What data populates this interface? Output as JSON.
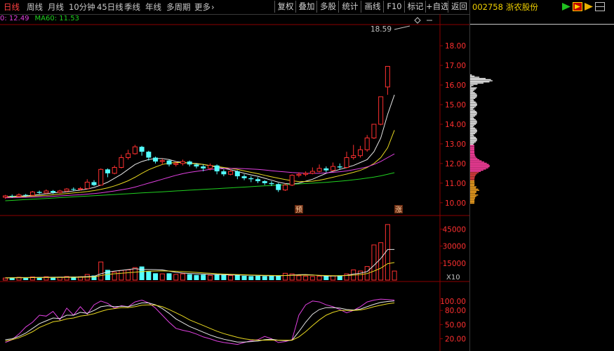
{
  "toolbar": {
    "tabs": [
      {
        "label": "日线",
        "active": true
      },
      {
        "label": "周线",
        "active": false
      },
      {
        "label": "月线",
        "active": false
      },
      {
        "label": "10分钟",
        "active": false
      },
      {
        "label": "45日线",
        "active": false
      },
      {
        "label": "季线",
        "active": false
      },
      {
        "label": "年线",
        "active": false
      },
      {
        "label": "多周期",
        "active": false
      },
      {
        "label": "更多",
        "active": false
      }
    ],
    "buttons": [
      "复权",
      "叠加",
      "多股",
      "统计",
      "画线",
      "F10",
      "标记",
      "+自选",
      "返回"
    ]
  },
  "ma_info": {
    "items": [
      {
        "text": "0: 12.49",
        "color": "#e040e0"
      },
      {
        "text": "MA60: 11.53",
        "color": "#20d020"
      }
    ]
  },
  "stock": {
    "code": "002758",
    "name": "浙农股份"
  },
  "price_axis": {
    "labels": [
      "18.00",
      "17.00",
      "16.00",
      "15.00",
      "14.00",
      "13.00",
      "12.00",
      "11.00",
      "10.00"
    ]
  },
  "volume_axis": {
    "labels": [
      "45000",
      "30000",
      "15000"
    ],
    "unit_label": "X10"
  },
  "indicator_axis": {
    "labels": [
      "100.00",
      "80.00",
      "50.00",
      "20.00"
    ]
  },
  "annotations": {
    "high_label": "18.59",
    "marker_pre": "预",
    "marker_up": "涨"
  },
  "chart_data": {
    "type": "candlestick",
    "price_ylim": [
      9.6,
      18.9
    ],
    "candles": [
      [
        10.28,
        10.35,
        10.2,
        10.4
      ],
      [
        10.35,
        10.33,
        10.25,
        10.42
      ],
      [
        10.33,
        10.4,
        10.3,
        10.48
      ],
      [
        10.4,
        10.38,
        10.3,
        10.45
      ],
      [
        10.38,
        10.55,
        10.35,
        10.6
      ],
      [
        10.55,
        10.5,
        10.45,
        10.62
      ],
      [
        10.5,
        10.6,
        10.45,
        10.68
      ],
      [
        10.6,
        10.52,
        10.45,
        10.65
      ],
      [
        10.52,
        10.6,
        10.48,
        10.66
      ],
      [
        10.6,
        10.7,
        10.55,
        10.75
      ],
      [
        10.7,
        10.68,
        10.6,
        10.78
      ],
      [
        10.68,
        10.72,
        10.62,
        10.8
      ],
      [
        10.72,
        11.05,
        10.7,
        11.2
      ],
      [
        11.05,
        10.9,
        10.85,
        11.15
      ],
      [
        10.9,
        11.7,
        10.88,
        11.75
      ],
      [
        11.7,
        11.5,
        11.3,
        11.75
      ],
      [
        11.5,
        11.8,
        11.45,
        11.9
      ],
      [
        11.8,
        12.3,
        11.75,
        12.45
      ],
      [
        12.3,
        12.5,
        12.2,
        12.7
      ],
      [
        12.5,
        12.85,
        12.45,
        12.95
      ],
      [
        12.85,
        12.6,
        12.4,
        12.9
      ],
      [
        12.6,
        12.3,
        12.15,
        12.65
      ],
      [
        12.3,
        12.1,
        12.0,
        12.35
      ],
      [
        12.1,
        12.15,
        11.95,
        12.25
      ],
      [
        12.15,
        11.95,
        11.85,
        12.2
      ],
      [
        11.95,
        12.0,
        11.85,
        12.1
      ],
      [
        12.0,
        12.1,
        11.9,
        12.2
      ],
      [
        12.1,
        11.95,
        11.85,
        12.15
      ],
      [
        11.95,
        11.85,
        11.75,
        12.0
      ],
      [
        11.85,
        11.75,
        11.6,
        11.95
      ],
      [
        11.75,
        11.9,
        11.65,
        12.0
      ],
      [
        11.9,
        11.6,
        11.45,
        11.95
      ],
      [
        11.6,
        11.45,
        11.35,
        11.7
      ],
      [
        11.45,
        11.6,
        11.4,
        11.7
      ],
      [
        11.6,
        11.35,
        11.2,
        11.65
      ],
      [
        11.35,
        11.25,
        11.15,
        11.45
      ],
      [
        11.25,
        11.2,
        11.05,
        11.35
      ],
      [
        11.2,
        11.1,
        11.0,
        11.3
      ],
      [
        11.1,
        11.0,
        10.9,
        11.15
      ],
      [
        11.0,
        10.95,
        10.85,
        11.1
      ],
      [
        10.95,
        10.65,
        10.55,
        11.0
      ],
      [
        10.65,
        10.9,
        10.6,
        10.98
      ],
      [
        10.9,
        11.4,
        10.85,
        11.45
      ],
      [
        11.4,
        11.45,
        11.3,
        11.55
      ],
      [
        11.45,
        11.5,
        11.35,
        11.6
      ],
      [
        11.5,
        11.6,
        11.45,
        11.8
      ],
      [
        11.6,
        11.75,
        11.55,
        11.95
      ],
      [
        11.75,
        11.65,
        11.55,
        11.85
      ],
      [
        11.65,
        11.85,
        11.6,
        12.05
      ],
      [
        11.85,
        11.8,
        11.7,
        12.0
      ],
      [
        11.8,
        12.3,
        11.75,
        12.6
      ],
      [
        12.3,
        12.4,
        12.2,
        12.95
      ],
      [
        12.4,
        12.7,
        12.3,
        12.9
      ],
      [
        12.7,
        13.3,
        12.6,
        13.45
      ],
      [
        13.3,
        14.0,
        13.25,
        14.0
      ],
      [
        14.0,
        15.4,
        13.95,
        15.4
      ],
      [
        15.9,
        16.95,
        15.5,
        16.95
      ]
    ],
    "ma": [
      {
        "name": "MA5",
        "color": "#e8e8e8",
        "values": [
          10.3,
          10.32,
          10.34,
          10.35,
          10.38,
          10.42,
          10.46,
          10.5,
          10.53,
          10.56,
          10.6,
          10.64,
          10.7,
          10.78,
          10.9,
          11.05,
          11.25,
          11.45,
          11.7,
          11.95,
          12.1,
          12.2,
          12.25,
          12.25,
          12.2,
          12.1,
          12.05,
          12.02,
          12.0,
          11.95,
          11.88,
          11.82,
          11.75,
          11.68,
          11.6,
          11.5,
          11.42,
          11.35,
          11.25,
          11.15,
          11.05,
          10.98,
          10.95,
          11.0,
          11.1,
          11.2,
          11.35,
          11.5,
          11.6,
          11.7,
          11.8,
          11.9,
          12.05,
          12.2,
          12.6,
          13.3,
          14.5,
          15.5
        ]
      },
      {
        "name": "MA10",
        "color": "#e8d820",
        "values": [
          10.28,
          10.3,
          10.31,
          10.32,
          10.34,
          10.36,
          10.38,
          10.41,
          10.44,
          10.47,
          10.5,
          10.53,
          10.57,
          10.62,
          10.68,
          10.76,
          10.86,
          10.98,
          11.12,
          11.3,
          11.5,
          11.68,
          11.82,
          11.95,
          12.02,
          12.05,
          12.05,
          12.02,
          11.98,
          11.95,
          11.9,
          11.85,
          11.8,
          11.75,
          11.7,
          11.62,
          11.55,
          11.48,
          11.4,
          11.32,
          11.25,
          11.18,
          11.12,
          11.08,
          11.08,
          11.1,
          11.15,
          11.22,
          11.3,
          11.38,
          11.46,
          11.55,
          11.65,
          11.8,
          12.0,
          12.3,
          12.8,
          13.7
        ]
      },
      {
        "name": "MA20",
        "color": "#e040e0",
        "values": [
          10.25,
          10.26,
          10.27,
          10.28,
          10.29,
          10.3,
          10.31,
          10.33,
          10.35,
          10.37,
          10.39,
          10.41,
          10.44,
          10.47,
          10.5,
          10.55,
          10.6,
          10.66,
          10.72,
          10.8,
          10.9,
          11.0,
          11.1,
          11.2,
          11.3,
          11.4,
          11.48,
          11.55,
          11.6,
          11.65,
          11.7,
          11.72,
          11.74,
          11.75,
          11.75,
          11.74,
          11.72,
          11.7,
          11.67,
          11.63,
          11.6,
          11.57,
          11.54,
          11.52,
          11.5,
          11.5,
          11.5,
          11.52,
          11.55,
          11.58,
          11.62,
          11.68,
          11.75,
          11.83,
          11.95,
          12.1,
          12.3,
          12.49
        ]
      },
      {
        "name": "MA60",
        "color": "#20d020",
        "values": [
          10.1,
          10.12,
          10.14,
          10.16,
          10.18,
          10.2,
          10.22,
          10.24,
          10.26,
          10.28,
          10.3,
          10.32,
          10.34,
          10.36,
          10.38,
          10.4,
          10.42,
          10.44,
          10.46,
          10.48,
          10.5,
          10.52,
          10.54,
          10.56,
          10.58,
          10.6,
          10.62,
          10.64,
          10.66,
          10.68,
          10.7,
          10.72,
          10.74,
          10.76,
          10.78,
          10.8,
          10.82,
          10.84,
          10.86,
          10.88,
          10.9,
          10.92,
          10.94,
          10.96,
          10.98,
          11.0,
          11.02,
          11.04,
          11.07,
          11.1,
          11.13,
          11.17,
          11.21,
          11.26,
          11.31,
          11.37,
          11.45,
          11.53
        ]
      }
    ],
    "volume_ylim": [
      0,
      52000
    ],
    "volumes": [
      1800,
      2200,
      2500,
      1900,
      2800,
      2400,
      3000,
      2300,
      2600,
      3200,
      2800,
      3000,
      5000,
      4000,
      16000,
      9000,
      7000,
      8500,
      9000,
      11000,
      12000,
      8000,
      6000,
      5500,
      6000,
      5000,
      5500,
      5200,
      4500,
      4800,
      4200,
      5000,
      4800,
      4000,
      4500,
      3800,
      3500,
      3800,
      3500,
      4200,
      4000,
      6000,
      5500,
      3800,
      3500,
      3200,
      3500,
      4000,
      3800,
      4200,
      5500,
      9000,
      8000,
      12000,
      31000,
      33000,
      49000,
      8000
    ],
    "volume_ma": [
      {
        "name": "VMA5",
        "color": "#e8e8e8",
        "values": [
          2000,
          2100,
          2200,
          2250,
          2300,
          2400,
          2500,
          2550,
          2600,
          2700,
          2800,
          2850,
          3100,
          3300,
          5600,
          7100,
          8000,
          8600,
          9300,
          10000,
          9500,
          9300,
          9200,
          9000,
          8000,
          6800,
          6200,
          5800,
          5600,
          5300,
          5000,
          4900,
          4800,
          4600,
          4500,
          4400,
          4300,
          4100,
          3900,
          3900,
          3800,
          4000,
          4400,
          4800,
          4900,
          4600,
          4000,
          3600,
          3500,
          3700,
          4200,
          5300,
          6100,
          7500,
          13000,
          19000,
          27000,
          27000
        ]
      },
      {
        "name": "VMA10",
        "color": "#e8d820",
        "values": [
          1900,
          2000,
          2050,
          2100,
          2150,
          2200,
          2250,
          2300,
          2350,
          2400,
          2450,
          2500,
          2650,
          2800,
          4000,
          5000,
          5600,
          6000,
          6500,
          7000,
          7500,
          7800,
          8000,
          8100,
          8000,
          7800,
          7500,
          7200,
          6800,
          6400,
          6000,
          5600,
          5300,
          5100,
          4900,
          4700,
          4500,
          4350,
          4200,
          4100,
          4000,
          4050,
          4200,
          4400,
          4500,
          4400,
          4200,
          4000,
          3900,
          3900,
          4000,
          4400,
          4900,
          5700,
          8000,
          10500,
          14500,
          15500
        ]
      }
    ],
    "indicator_ylim": [
      0,
      125
    ],
    "indicator": [
      {
        "name": "K",
        "color": "#e040e0",
        "values": [
          12,
          18,
          30,
          45,
          55,
          70,
          68,
          78,
          60,
          85,
          70,
          88,
          72,
          92,
          100,
          95,
          85,
          90,
          88,
          98,
          102,
          96,
          85,
          70,
          55,
          42,
          38,
          35,
          30,
          24,
          20,
          15,
          12,
          10,
          8,
          12,
          16,
          18,
          25,
          20,
          12,
          14,
          18,
          70,
          92,
          100,
          98,
          92,
          88,
          82,
          75,
          80,
          88,
          98,
          102,
          104,
          103,
          102
        ]
      },
      {
        "name": "D",
        "color": "#e8e8e8",
        "values": [
          18,
          20,
          25,
          32,
          42,
          52,
          58,
          64,
          63,
          70,
          70,
          76,
          74,
          80,
          88,
          90,
          88,
          89,
          88,
          92,
          96,
          96,
          92,
          84,
          74,
          62,
          54,
          46,
          40,
          34,
          28,
          23,
          19,
          16,
          13,
          13,
          14,
          15,
          18,
          19,
          17,
          16,
          17,
          35,
          55,
          72,
          82,
          86,
          86,
          85,
          82,
          81,
          83,
          88,
          93,
          97,
          99,
          100
        ]
      },
      {
        "name": "J",
        "color": "#e8d820",
        "values": [
          15,
          18,
          22,
          28,
          35,
          44,
          50,
          56,
          58,
          62,
          64,
          68,
          70,
          73,
          78,
          82,
          84,
          86,
          86,
          88,
          91,
          92,
          91,
          88,
          82,
          75,
          68,
          60,
          54,
          48,
          42,
          36,
          31,
          27,
          23,
          20,
          18,
          17,
          17,
          17,
          17,
          17,
          17,
          24,
          35,
          48,
          60,
          70,
          76,
          80,
          80,
          80,
          81,
          84,
          88,
          91,
          94,
          96
        ]
      }
    ]
  }
}
